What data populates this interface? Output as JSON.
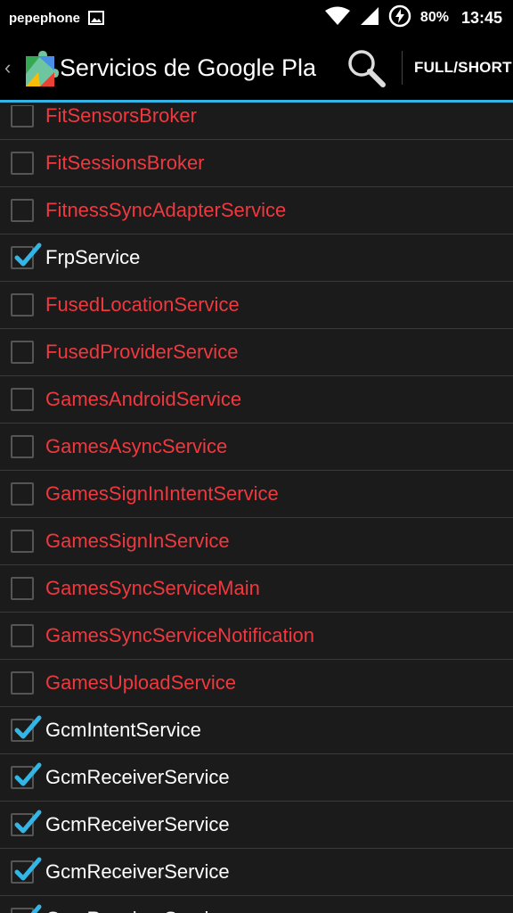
{
  "status_bar": {
    "carrier": "pepephone",
    "battery": "80%",
    "time": "13:45"
  },
  "action_bar": {
    "title": "Servicios de Google Pla",
    "toggle_label": "FULL/SHORT",
    "accent_color": "#33b5e5"
  },
  "colors": {
    "disabled_text": "#f0383f",
    "enabled_text": "#ffffff",
    "check": "#33b5e5"
  },
  "services": [
    {
      "name": "FitSensorsBroker",
      "checked": false
    },
    {
      "name": "FitSessionsBroker",
      "checked": false
    },
    {
      "name": "FitnessSyncAdapterService",
      "checked": false
    },
    {
      "name": "FrpService",
      "checked": true
    },
    {
      "name": "FusedLocationService",
      "checked": false
    },
    {
      "name": "FusedProviderService",
      "checked": false
    },
    {
      "name": "GamesAndroidService",
      "checked": false
    },
    {
      "name": "GamesAsyncService",
      "checked": false
    },
    {
      "name": "GamesSignInIntentService",
      "checked": false
    },
    {
      "name": "GamesSignInService",
      "checked": false
    },
    {
      "name": "GamesSyncServiceMain",
      "checked": false
    },
    {
      "name": "GamesSyncServiceNotification",
      "checked": false
    },
    {
      "name": "GamesUploadService",
      "checked": false
    },
    {
      "name": "GcmIntentService",
      "checked": true
    },
    {
      "name": "GcmReceiverService",
      "checked": true
    },
    {
      "name": "GcmReceiverService",
      "checked": true
    },
    {
      "name": "GcmReceiverService",
      "checked": true
    },
    {
      "name": "GcmReceiverService",
      "checked": true
    }
  ]
}
